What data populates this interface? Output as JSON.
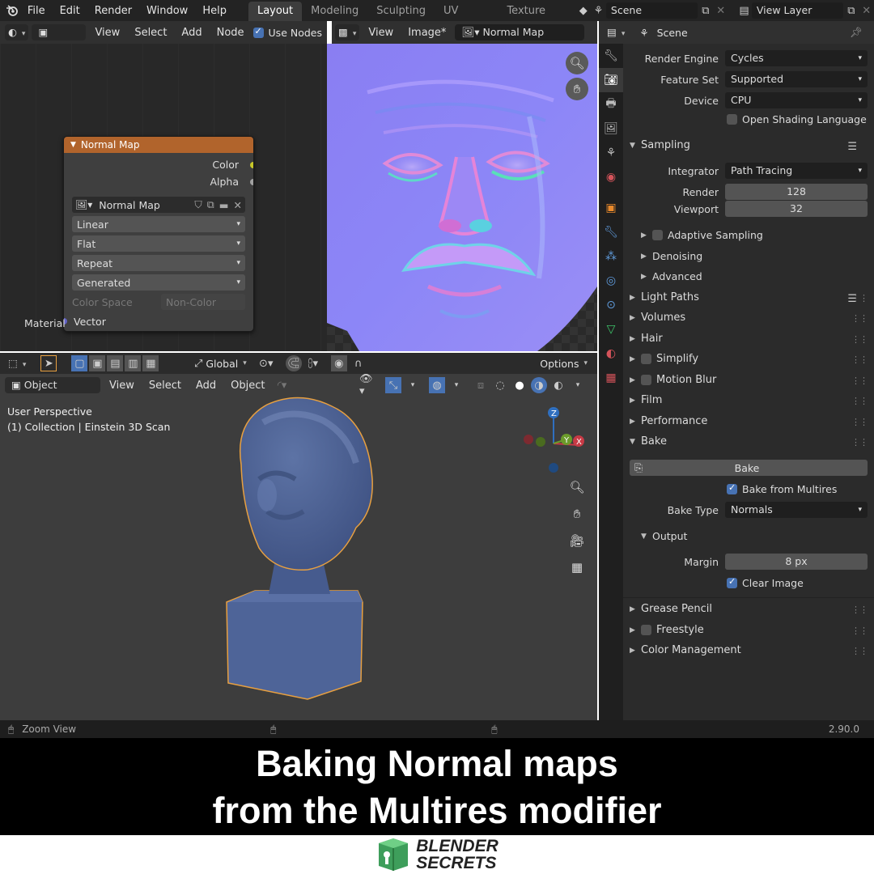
{
  "topbar": {
    "menus": [
      "File",
      "Edit",
      "Render",
      "Window",
      "Help"
    ],
    "workspaces": [
      "Layout",
      "Modeling",
      "Sculpting",
      "UV Editing",
      "Texture Paint"
    ],
    "active_workspace": "Layout",
    "scene": "Scene",
    "view_layer": "View Layer"
  },
  "node_editor": {
    "header": {
      "object_type": "Object",
      "menus": [
        "View",
        "Select",
        "Add",
        "Node"
      ],
      "use_nodes_label": "Use Nodes"
    },
    "node": {
      "title": "Normal Map",
      "outputs": [
        "Color",
        "Alpha"
      ],
      "image_name": "Normal Map",
      "interpolation": "Linear",
      "projection": "Flat",
      "extension": "Repeat",
      "source": "Generated",
      "color_space_label": "Color Space",
      "color_space_value": "Non-Color",
      "input": "Vector",
      "socket_colors": {
        "color": "#c7c729",
        "alpha": "#a1a1a1",
        "vector": "#6363c7"
      }
    },
    "footer_label": "Material"
  },
  "image_editor": {
    "header": {
      "menus": [
        "View",
        "Image*"
      ],
      "image_name": "Normal Map"
    }
  },
  "viewport": {
    "tool_header": {
      "orientation": "Global",
      "options_label": "Options"
    },
    "header": {
      "mode": "Object Mode",
      "menus": [
        "View",
        "Select",
        "Add",
        "Object"
      ]
    },
    "overlay_text": {
      "line1": "User Perspective",
      "line2": "(1) Collection | Einstein 3D Scan"
    },
    "gizmo": {
      "z_label": "Z",
      "y_label": "Y",
      "x_label": "X"
    }
  },
  "properties": {
    "header_title": "Scene",
    "render_engine": {
      "label": "Render Engine",
      "value": "Cycles"
    },
    "feature_set": {
      "label": "Feature Set",
      "value": "Supported"
    },
    "device": {
      "label": "Device",
      "value": "CPU"
    },
    "osl_label": "Open Shading Language",
    "sampling": {
      "title": "Sampling",
      "integrator_label": "Integrator",
      "integrator_value": "Path Tracing",
      "render_label": "Render",
      "render_value": "128",
      "viewport_label": "Viewport",
      "viewport_value": "32",
      "subsections": [
        "Adaptive Sampling",
        "Denoising",
        "Advanced"
      ]
    },
    "panels_a": [
      "Light Paths",
      "Volumes",
      "Hair",
      "Simplify",
      "Motion Blur",
      "Film",
      "Performance"
    ],
    "bake": {
      "title": "Bake",
      "button_label": "Bake",
      "from_multires_label": "Bake from Multires",
      "bake_type_label": "Bake Type",
      "bake_type_value": "Normals",
      "output_title": "Output",
      "margin_label": "Margin",
      "margin_value": "8 px",
      "clear_image_label": "Clear Image"
    },
    "panels_b": [
      "Grease Pencil",
      "Freestyle",
      "Color Management"
    ]
  },
  "status_bar": {
    "left": "Zoom View",
    "version": "2.90.0"
  },
  "caption": {
    "line1": "Baking Normal maps",
    "line2": "from the Multires modifier"
  },
  "logo": {
    "line1": "BLENDER",
    "line2": "SECRETS"
  },
  "colors": {
    "node_header": "#b1642c",
    "accent_blue": "#4772b3",
    "selection_outline": "#e8a040"
  }
}
